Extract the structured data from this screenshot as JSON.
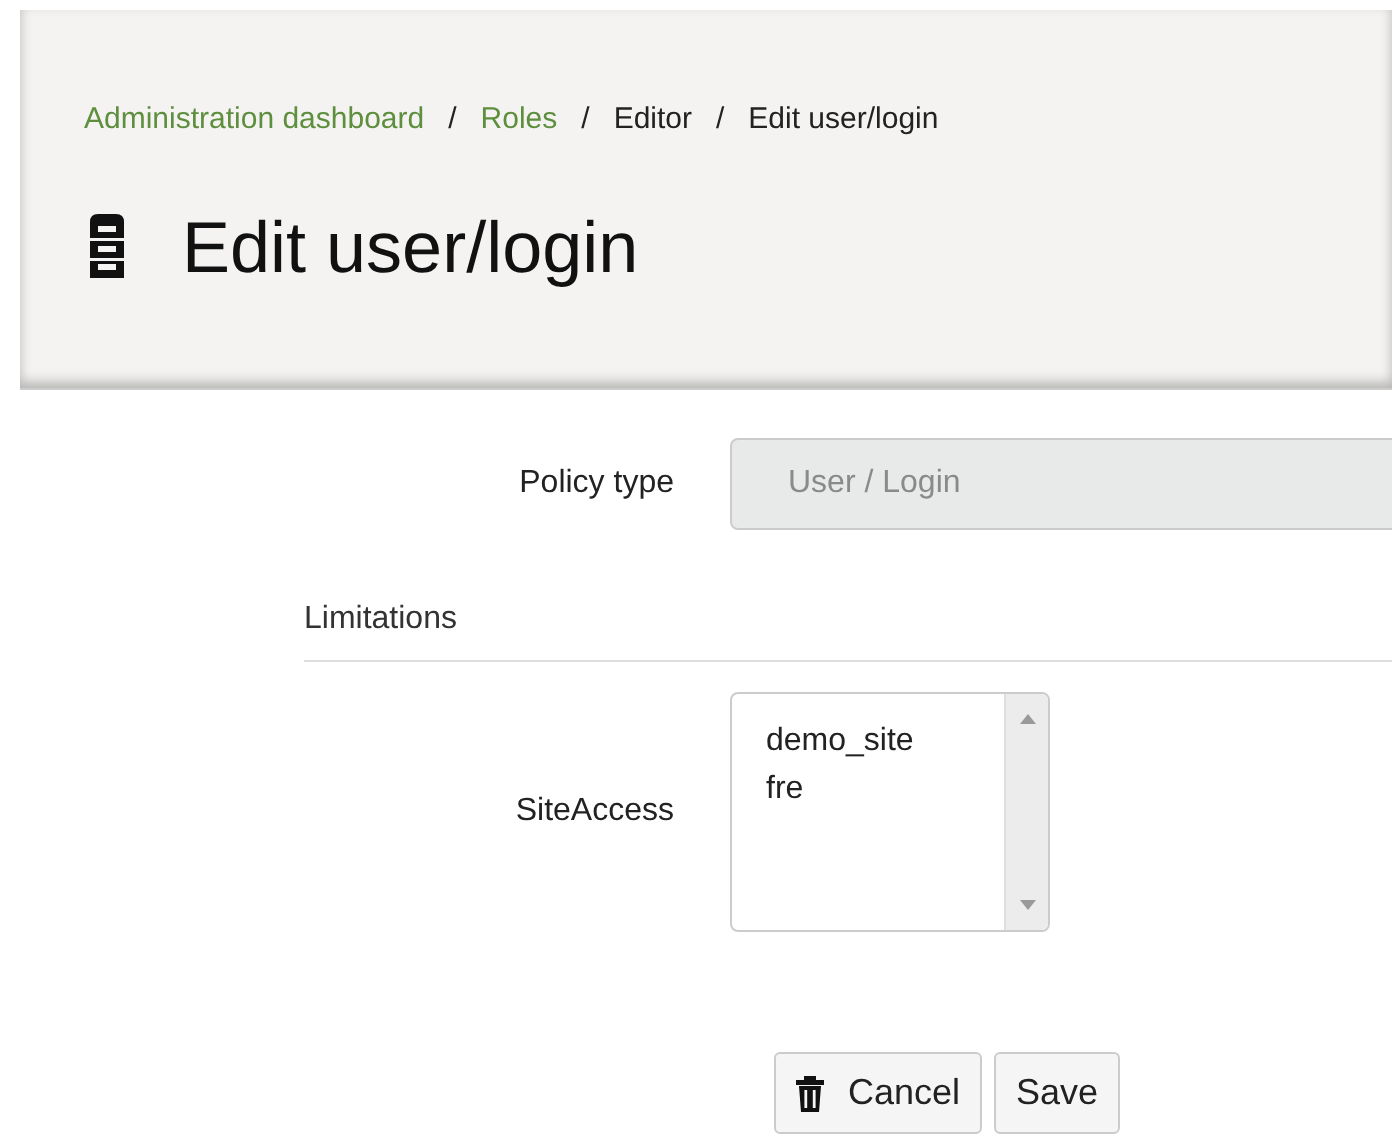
{
  "breadcrumb": [
    {
      "label": "Administration dashboard",
      "link": true
    },
    {
      "separator": "/",
      "label": "Roles",
      "link": true
    },
    {
      "separator": "/",
      "label": "Editor",
      "link": false
    },
    {
      "separator": "/",
      "label": "Edit user/login",
      "link": false
    }
  ],
  "title": "Edit user/login",
  "policy_type": {
    "label": "Policy type",
    "value": "User / Login",
    "disabled": true
  },
  "limitations": {
    "heading": "Limitations",
    "fields": [
      {
        "label": "SiteAccess",
        "options": [
          {
            "label": "demo_site",
            "selected": false
          },
          {
            "label": "fre",
            "selected": false
          }
        ]
      }
    ]
  },
  "buttons": [
    {
      "label": "Cancel",
      "kind": "cancel"
    },
    {
      "label": "Save",
      "kind": "save"
    }
  ]
}
